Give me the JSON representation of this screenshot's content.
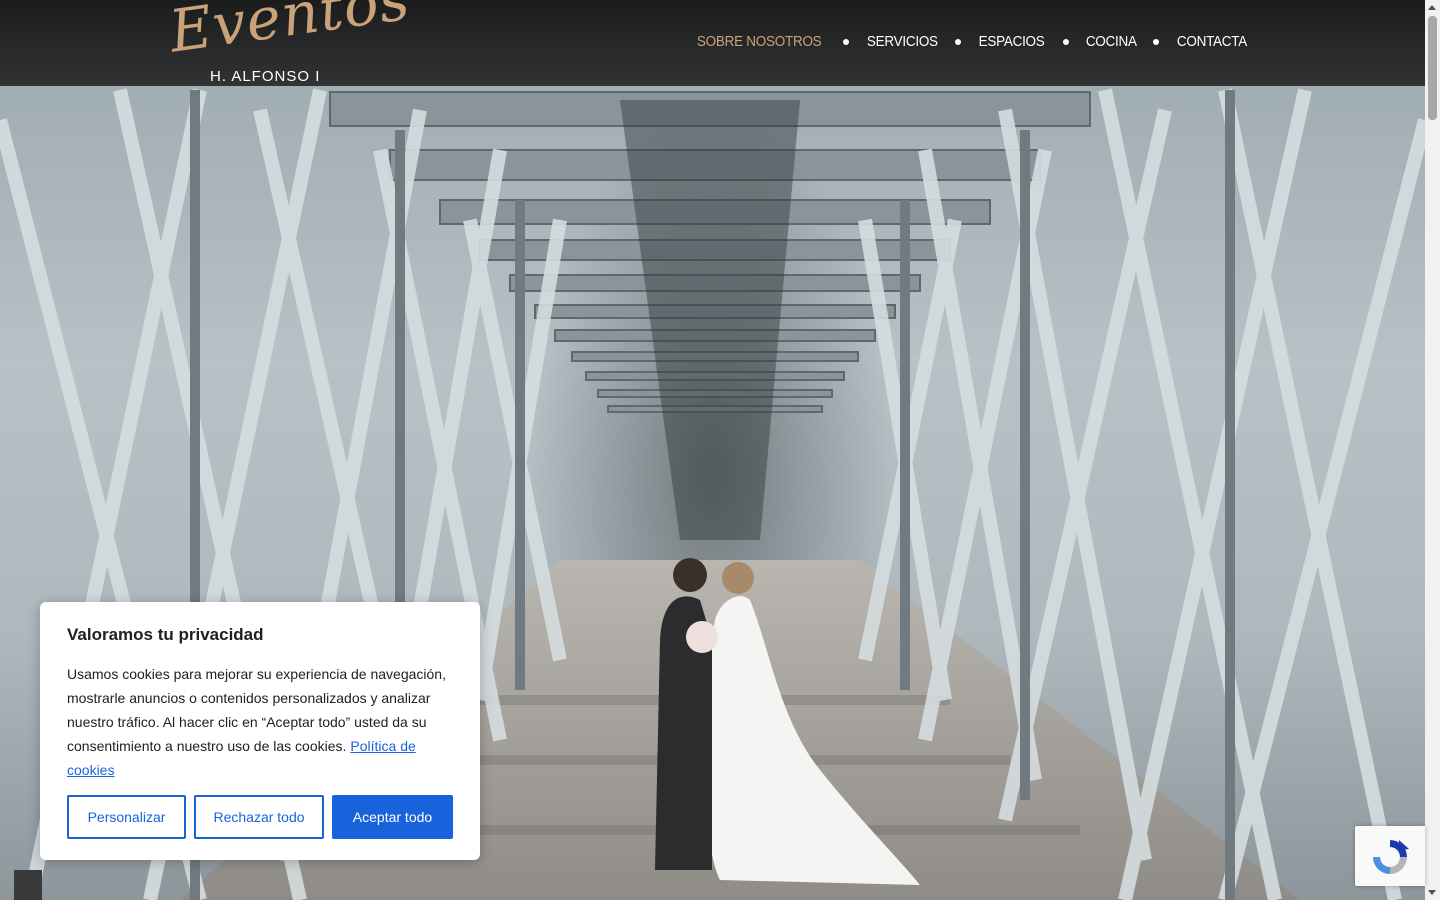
{
  "header": {
    "logo_script": "Eventos",
    "logo_subtitle": "H. ALFONSO I",
    "nav": [
      {
        "label": "SOBRE NOSOTROS",
        "active": true
      },
      {
        "label": "SERVICIOS",
        "active": false
      },
      {
        "label": "ESPACIOS",
        "active": false
      },
      {
        "label": "COCINA",
        "active": false
      },
      {
        "label": "CONTACTA",
        "active": false
      }
    ]
  },
  "cookie_banner": {
    "title": "Valoramos tu privacidad",
    "text": "Usamos cookies para mejorar su experiencia de navegación, mostrarle anuncios o contenidos personalizados y analizar nuestro tráfico. Al hacer clic en “Aceptar todo” usted da su consentimiento a nuestro uso de las cookies.",
    "policy_link": "Política de cookies",
    "buttons": {
      "customize": "Personalizar",
      "reject": "Rechazar todo",
      "accept": "Aceptar todo"
    }
  },
  "colors": {
    "accent_gold": "#c9a27a",
    "cookie_blue": "#1863dc",
    "header_bg": "#1e1e1e"
  },
  "icons": {
    "recaptcha": "recaptcha-icon"
  }
}
